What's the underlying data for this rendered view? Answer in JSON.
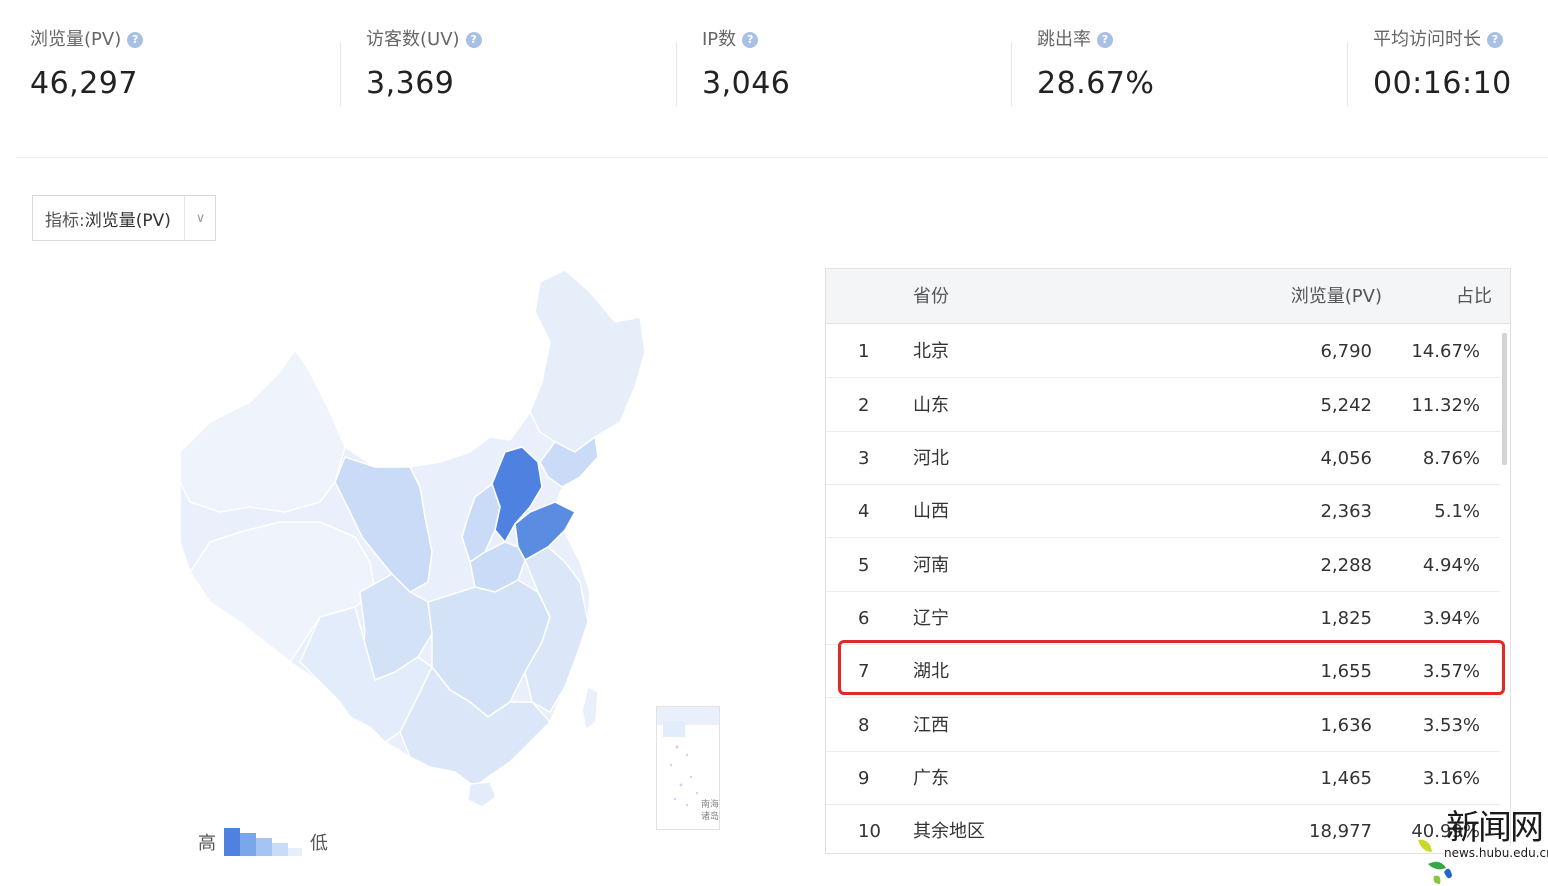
{
  "stats": [
    {
      "label": "浏览量(PV)",
      "value": "46,297",
      "help": "?"
    },
    {
      "label": "访客数(UV)",
      "value": "3,369",
      "help": "?"
    },
    {
      "label": "IP数",
      "value": "3,046",
      "help": "?"
    },
    {
      "label": "跳出率",
      "value": "28.67%",
      "help": "?"
    },
    {
      "label": "平均访问时长",
      "value": "00:16:10",
      "help": "?"
    }
  ],
  "selector": {
    "label": "指标:",
    "value": "浏览量(PV)",
    "caret": "∨"
  },
  "map": {
    "legend_high": "高",
    "legend_low": "低",
    "inset_label": "南海诸岛",
    "colors": {
      "high": "#4f82e0",
      "mid": "#7aa6ea",
      "low": "#c9dbf6",
      "lowest": "#e9f0fb",
      "border": "#ffffff"
    }
  },
  "table": {
    "headers": {
      "province": "省份",
      "pv": "浏览量(PV)",
      "share": "占比"
    },
    "rows": [
      {
        "rank": "1",
        "name": "北京",
        "pv": "6,790",
        "share": "14.67%"
      },
      {
        "rank": "2",
        "name": "山东",
        "pv": "5,242",
        "share": "11.32%"
      },
      {
        "rank": "3",
        "name": "河北",
        "pv": "4,056",
        "share": "8.76%"
      },
      {
        "rank": "4",
        "name": "山西",
        "pv": "2,363",
        "share": "5.1%"
      },
      {
        "rank": "5",
        "name": "河南",
        "pv": "2,288",
        "share": "4.94%"
      },
      {
        "rank": "6",
        "name": "辽宁",
        "pv": "1,825",
        "share": "3.94%"
      },
      {
        "rank": "7",
        "name": "湖北",
        "pv": "1,655",
        "share": "3.57%"
      },
      {
        "rank": "8",
        "name": "江西",
        "pv": "1,636",
        "share": "3.53%"
      },
      {
        "rank": "9",
        "name": "广东",
        "pv": "1,465",
        "share": "3.16%"
      },
      {
        "rank": "10",
        "name": "其余地区",
        "pv": "18,977",
        "share": "40.99%"
      }
    ],
    "highlight_color": "#e02a2a"
  },
  "watermark": {
    "logo": "新闻网",
    "url": "news.hubu.edu.cn"
  }
}
